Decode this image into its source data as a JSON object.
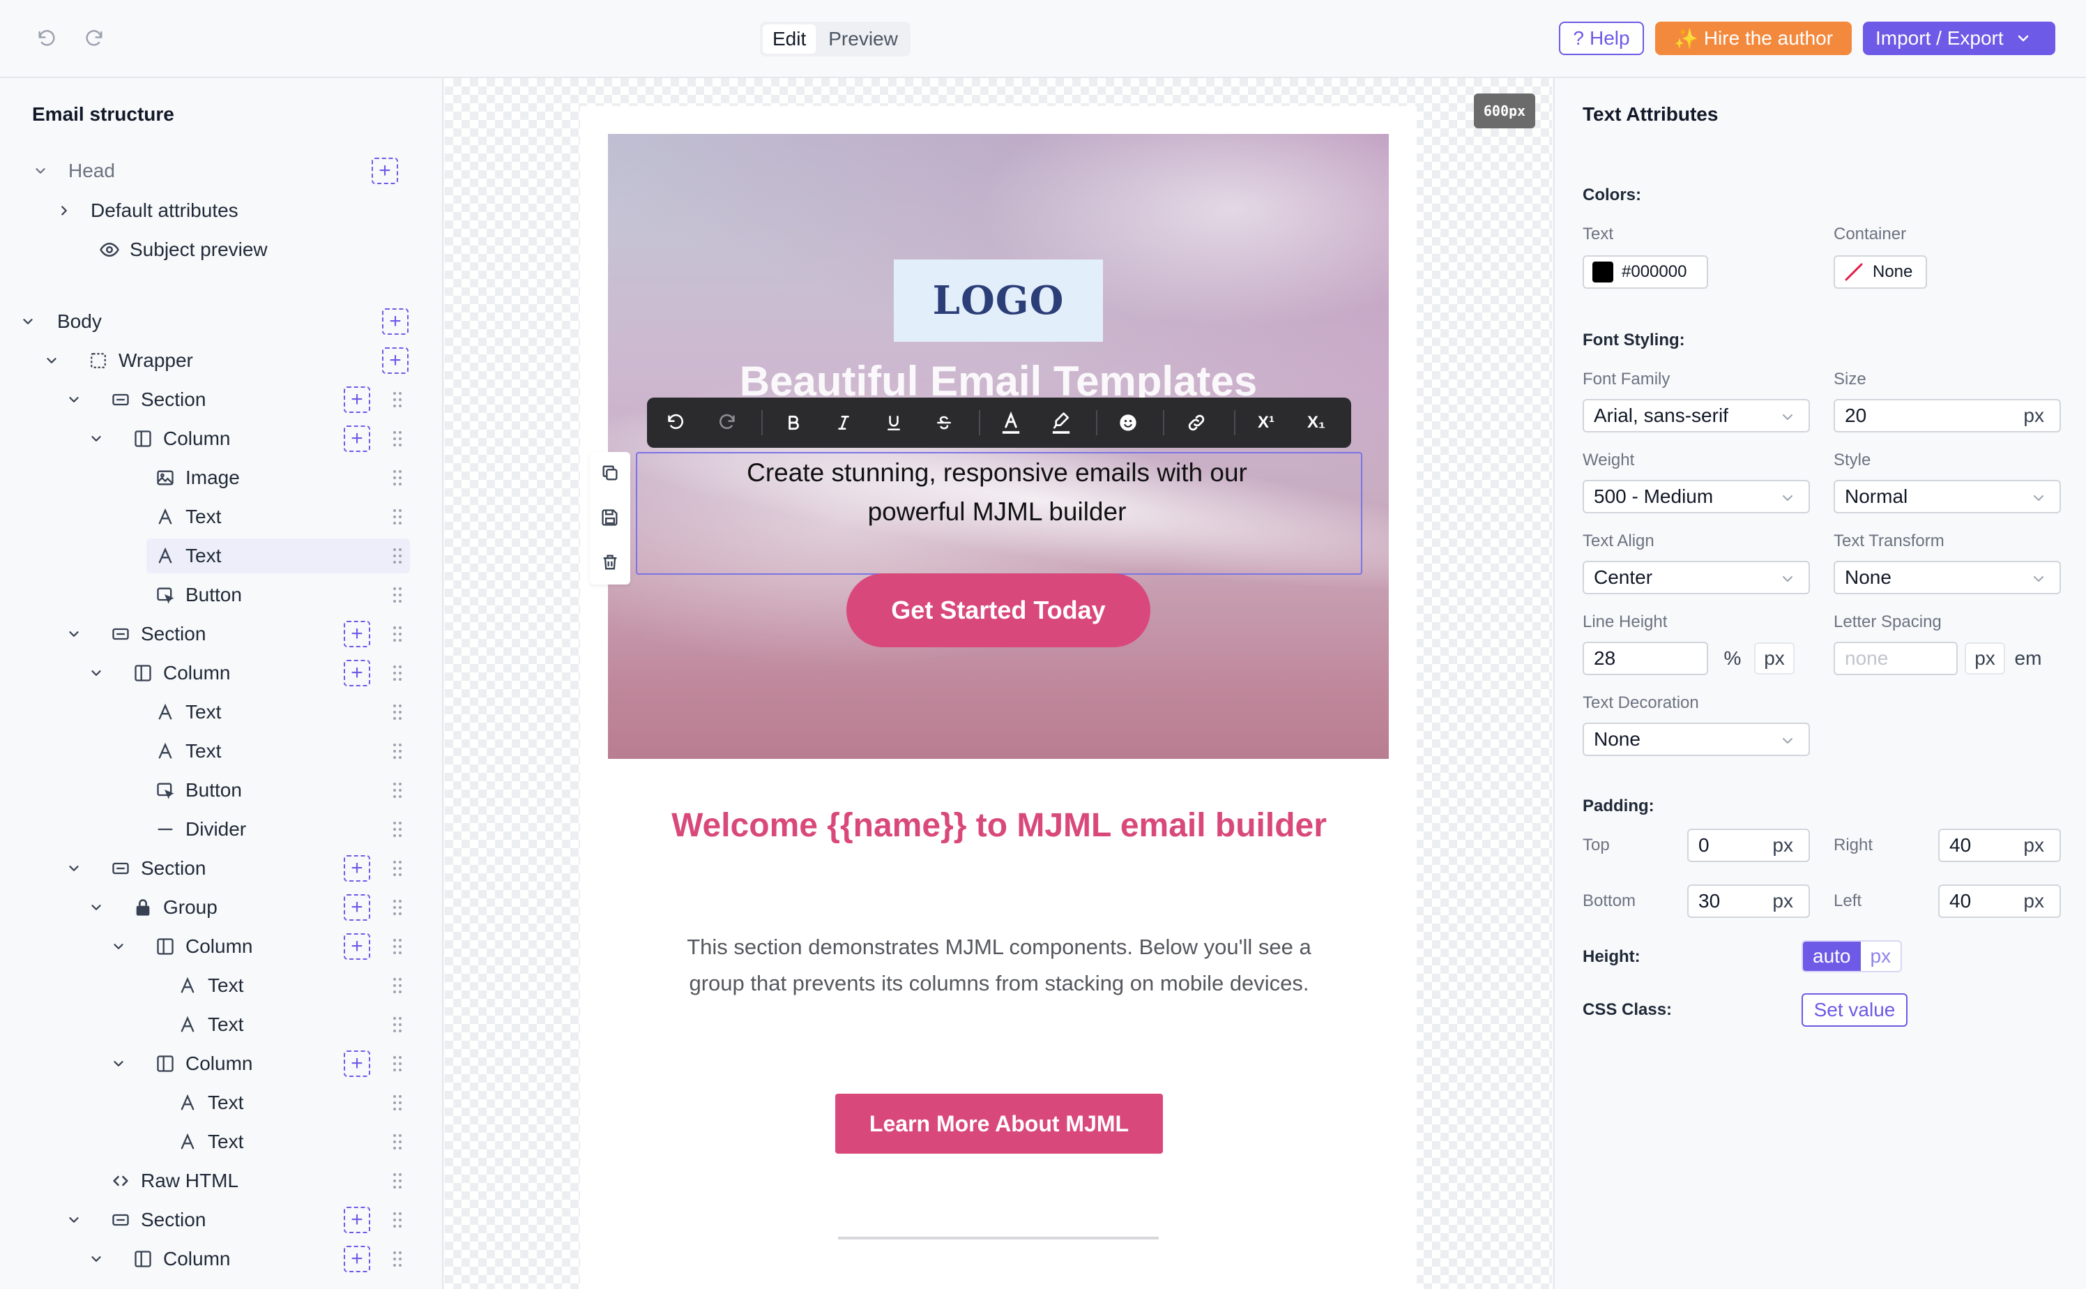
{
  "toolbar": {
    "modes": [
      "Edit",
      "Preview"
    ],
    "active_mode": "Edit",
    "help_label": "Help",
    "help_icon": "?",
    "hire_label": "Hire the author",
    "hire_icon": "✨",
    "import_label": "Import / Export"
  },
  "structure": {
    "title": "Email structure",
    "head": "Head",
    "default_attributes": "Default attributes",
    "subject_preview": "Subject preview",
    "body": "Body",
    "wrapper": "Wrapper",
    "section": "Section",
    "column": "Column",
    "group": "Group",
    "image": "Image",
    "text": "Text",
    "button": "Button",
    "divider": "Divider",
    "raw_html": "Raw HTML"
  },
  "canvas": {
    "width_badge": "600px",
    "logo": "LOGO",
    "hero_title": "Beautiful Email Templates",
    "hero_text_line1": "Create stunning, responsive emails with our",
    "hero_text_line2": "powerful MJML builder",
    "hero_cta": "Get Started Today",
    "welcome_title": "Welcome {{name}} to MJML email builder",
    "welcome_body": "This section demonstrates MJML components. Below you'll see a group that prevents its columns from stacking on mobile devices.",
    "learn_more": "Learn More About MJML",
    "format_toolbar_items": [
      "undo",
      "redo",
      "bold",
      "italic",
      "underline",
      "strikethrough",
      "text-color",
      "highlight",
      "emoji",
      "link",
      "superscript",
      "subscript"
    ],
    "format_superscript": "X¹",
    "format_subscript": "X₁"
  },
  "attributes": {
    "title": "Text Attributes",
    "colors_heading": "Colors:",
    "text_color_label": "Text",
    "text_color_value": "#000000",
    "container_label": "Container",
    "container_value": "None",
    "font_heading": "Font Styling:",
    "font_family_label": "Font Family",
    "font_family_value": "Arial, sans-serif",
    "size_label": "Size",
    "size_value": "20",
    "size_unit": "px",
    "weight_label": "Weight",
    "weight_value": "500 - Medium",
    "style_label": "Style",
    "style_value": "Normal",
    "align_label": "Text Align",
    "align_value": "Center",
    "transform_label": "Text Transform",
    "transform_value": "None",
    "line_height_label": "Line Height",
    "line_height_value": "28",
    "line_height_units": [
      "%",
      "px"
    ],
    "letter_spacing_label": "Letter Spacing",
    "letter_spacing_placeholder": "none",
    "letter_spacing_units": [
      "px",
      "em"
    ],
    "decoration_label": "Text Decoration",
    "decoration_value": "None",
    "padding_heading": "Padding:",
    "pad_top_label": "Top",
    "pad_top_value": "0",
    "pad_right_label": "Right",
    "pad_right_value": "40",
    "pad_bottom_label": "Bottom",
    "pad_bottom_value": "30",
    "pad_left_label": "Left",
    "pad_left_value": "40",
    "pad_unit": "px",
    "height_label": "Height:",
    "height_options": [
      "auto",
      "px"
    ],
    "css_class_label": "CSS Class:",
    "set_value_label": "Set value"
  },
  "colors": {
    "accent": "#6d5ae6",
    "hire": "#f3893d",
    "brand_pink": "#d9487a",
    "text_color_swatch": "#000000"
  }
}
